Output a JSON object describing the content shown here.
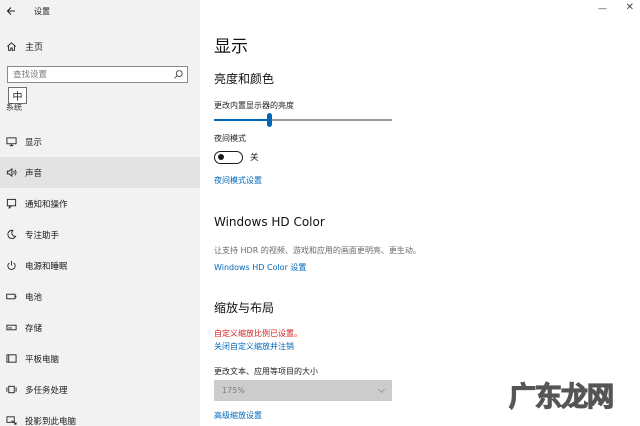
{
  "window": {
    "title": "设置",
    "back_icon": "back-arrow-icon",
    "minimize_icon": "minimize-icon",
    "close_icon": "close-icon"
  },
  "sidebar": {
    "home_label": "主页",
    "search_placeholder": "查找设置",
    "ime_indicator": "中",
    "section_label": "系统",
    "items": [
      {
        "label": "显示",
        "icon": "monitor-icon"
      },
      {
        "label": "声音",
        "icon": "speaker-icon",
        "active": true
      },
      {
        "label": "通知和操作",
        "icon": "notification-icon"
      },
      {
        "label": "专注助手",
        "icon": "moon-icon"
      },
      {
        "label": "电源和睡眠",
        "icon": "power-icon"
      },
      {
        "label": "电池",
        "icon": "battery-icon"
      },
      {
        "label": "存储",
        "icon": "storage-icon"
      },
      {
        "label": "平板电脑",
        "icon": "tablet-icon"
      },
      {
        "label": "多任务处理",
        "icon": "multitask-icon"
      },
      {
        "label": "投影到此电脑",
        "icon": "projector-icon"
      }
    ]
  },
  "main": {
    "title": "显示",
    "brightness": {
      "heading": "亮度和颜色",
      "slider_label": "更改内置显示器的亮度",
      "slider_value": 0.31,
      "night_mode_label": "夜间模式",
      "night_mode_state": "关",
      "night_mode_link": "夜间模式设置"
    },
    "hd_color": {
      "heading": "Windows HD Color",
      "description": "让支持 HDR 的视频、游戏和应用的画面更明亮、更生动。",
      "link": "Windows HD Color 设置"
    },
    "scale": {
      "heading": "缩放与布局",
      "custom_warning": "自定义缩放比例已设置。",
      "custom_link": "关闭自定义缩放并注销",
      "size_label": "更改文本、应用等项目的大小",
      "size_value": "175%",
      "advanced_link": "高级缩放设置"
    }
  },
  "watermark": {
    "text": "广东龙网"
  },
  "colors": {
    "accent": "#0067b8",
    "warning": "#d21f1f",
    "sidebar_bg": "#f2f2f2"
  }
}
